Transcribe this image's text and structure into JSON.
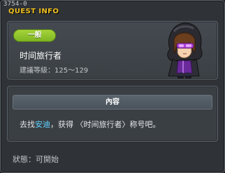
{
  "window": {
    "id": "3754-0",
    "title": "QUEST INFO"
  },
  "quest": {
    "category": "一般",
    "name": "时间旅行者",
    "level_label": "建議等級：",
    "level_range": "125～129",
    "npc_portrait_icon": "hooded-adventurer-portrait"
  },
  "content": {
    "header": "內容",
    "text_before": "去找",
    "npc_name": "安迪",
    "text_after": "，获得 〈时间旅行者〉称号吧。"
  },
  "status": {
    "label": "狀態：",
    "value": "可開始"
  },
  "colors": {
    "title": "#f0c020",
    "badge": "#8fc52c",
    "npc_link": "#5fd2ff"
  }
}
